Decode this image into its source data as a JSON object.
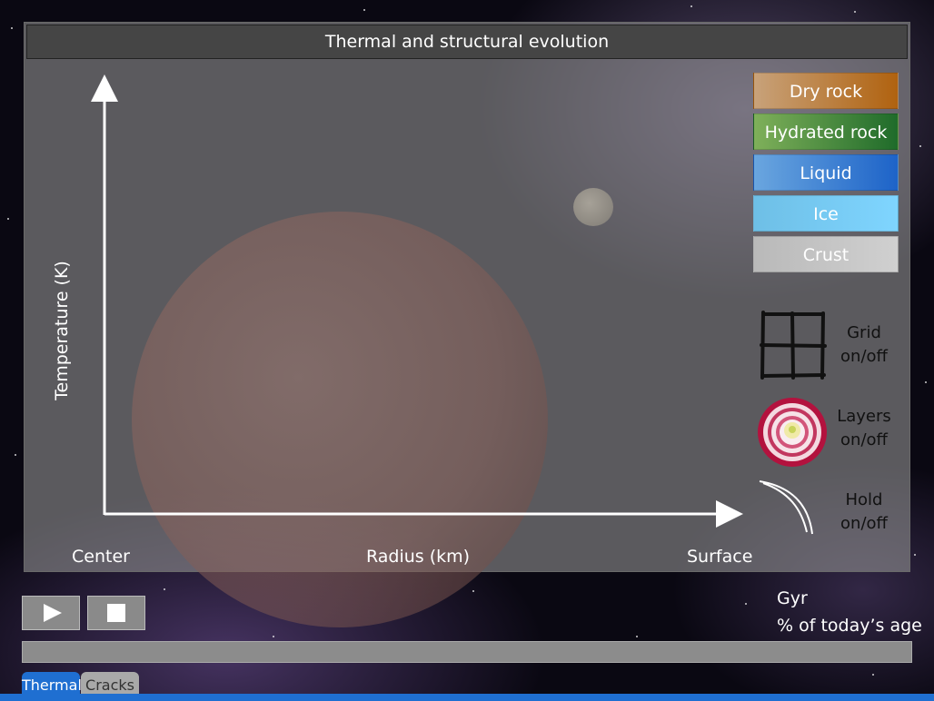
{
  "window": {
    "title": "Thermal and structural evolution"
  },
  "chart_data": {
    "type": "line",
    "title": "Thermal and structural evolution",
    "xlabel": "Radius (km)",
    "ylabel": "Temperature (K)",
    "x_tick_labels": [
      "Center",
      "Surface"
    ],
    "series": []
  },
  "legend": [
    {
      "label": "Dry rock",
      "color_from": "#c8a27a",
      "color_to": "#b0620f"
    },
    {
      "label": "Hydrated rock",
      "color_from": "#7fb05a",
      "color_to": "#1f6b2a"
    },
    {
      "label": "Liquid",
      "color_from": "#6aa6df",
      "color_to": "#1d63c8"
    },
    {
      "label": "Ice",
      "color_from": "#6ebfe6",
      "color_to": "#7fd5ff"
    },
    {
      "label": "Crust",
      "color_from": "#b9b9b9",
      "color_to": "#d0d0d0"
    }
  ],
  "toggles": {
    "grid": {
      "line1": "Grid",
      "line2": "on/off"
    },
    "layers": {
      "line1": "Layers",
      "line2": "on/off"
    },
    "hold": {
      "line1": "Hold",
      "line2": "on/off"
    }
  },
  "controls": {
    "play_icon": "play-icon",
    "stop_icon": "stop-icon"
  },
  "progress": {
    "fraction": 0.0
  },
  "readout": {
    "unit_line1": "Gyr",
    "unit_line2": "% of today’s age"
  },
  "tabs": [
    {
      "label": "Thermal",
      "active": true
    },
    {
      "label": "Cracks",
      "active": false
    }
  ],
  "colors": {
    "accent": "#1f6fd1",
    "panel_bg": "#969696",
    "title_bar": "#454545"
  }
}
